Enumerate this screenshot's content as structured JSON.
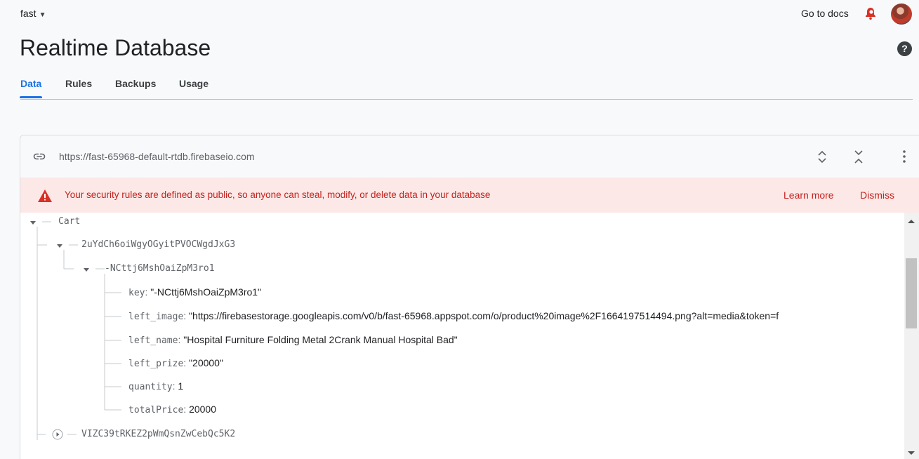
{
  "header": {
    "project": "fast",
    "docs_link": "Go to docs",
    "title": "Realtime Database"
  },
  "tabs": [
    {
      "label": "Data",
      "active": true
    },
    {
      "label": "Rules",
      "active": false
    },
    {
      "label": "Backups",
      "active": false
    },
    {
      "label": "Usage",
      "active": false
    }
  ],
  "database": {
    "url": "https://fast-65968-default-rtdb.firebaseio.com"
  },
  "warning": {
    "message": "Your security rules are defined as public, so anyone can steal, modify, or delete data in your database",
    "learn_more": "Learn more",
    "dismiss": "Dismiss"
  },
  "tree": {
    "root": "Cart",
    "user1": "2uYdCh6oiWgyOGyitPVOCWgdJxG3",
    "item1": "-NCttj6MshOaiZpM3ro1",
    "fields": [
      {
        "key": "key",
        "value": "\"-NCttj6MshOaiZpM3ro1\""
      },
      {
        "key": "left_image",
        "value": "\"https://firebasestorage.googleapis.com/v0/b/fast-65968.appspot.com/o/product%20image%2F1664197514494.png?alt=media&token=f"
      },
      {
        "key": "left_name",
        "value": "\"Hospital Furniture Folding Metal 2Crank Manual Hospital Bad\""
      },
      {
        "key": "left_prize",
        "value": "\"20000\""
      },
      {
        "key": "quantity",
        "value": "1"
      },
      {
        "key": "totalPrice",
        "value": "20000"
      }
    ],
    "user2": "VIZC39tRKEZ2pWmQsnZwCebQc5K2"
  },
  "colors": {
    "accent": "#1a73e8",
    "warning_bg": "#fce8e6",
    "warning_text": "#c5221f"
  },
  "icons": [
    "caret-down-icon",
    "notification-bell-icon",
    "help-icon",
    "link-icon",
    "expand-all-icon",
    "collapse-all-icon",
    "more-vert-icon",
    "warning-icon"
  ]
}
